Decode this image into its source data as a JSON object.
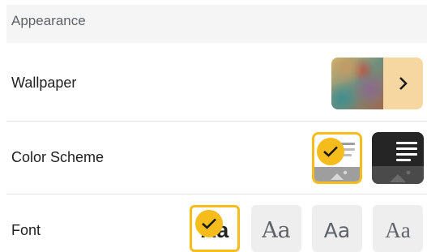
{
  "section": {
    "title": "Appearance"
  },
  "wallpaper": {
    "label": "Wallpaper",
    "action_icon": "chevron-right-icon"
  },
  "color_scheme": {
    "label": "Color Scheme",
    "options": [
      {
        "id": "light",
        "selected": true
      },
      {
        "id": "dark",
        "selected": false
      }
    ]
  },
  "font": {
    "label": "Font",
    "options": [
      {
        "sample": "Aa",
        "selected": true
      },
      {
        "sample": "Aa",
        "selected": false
      },
      {
        "sample": "Aa",
        "selected": false
      },
      {
        "sample": "Aa",
        "selected": false
      }
    ]
  },
  "colors": {
    "accent": "#f5bc1b",
    "header_bg": "#f5f5f5",
    "wallpaper_button": "#f6d6a1"
  }
}
